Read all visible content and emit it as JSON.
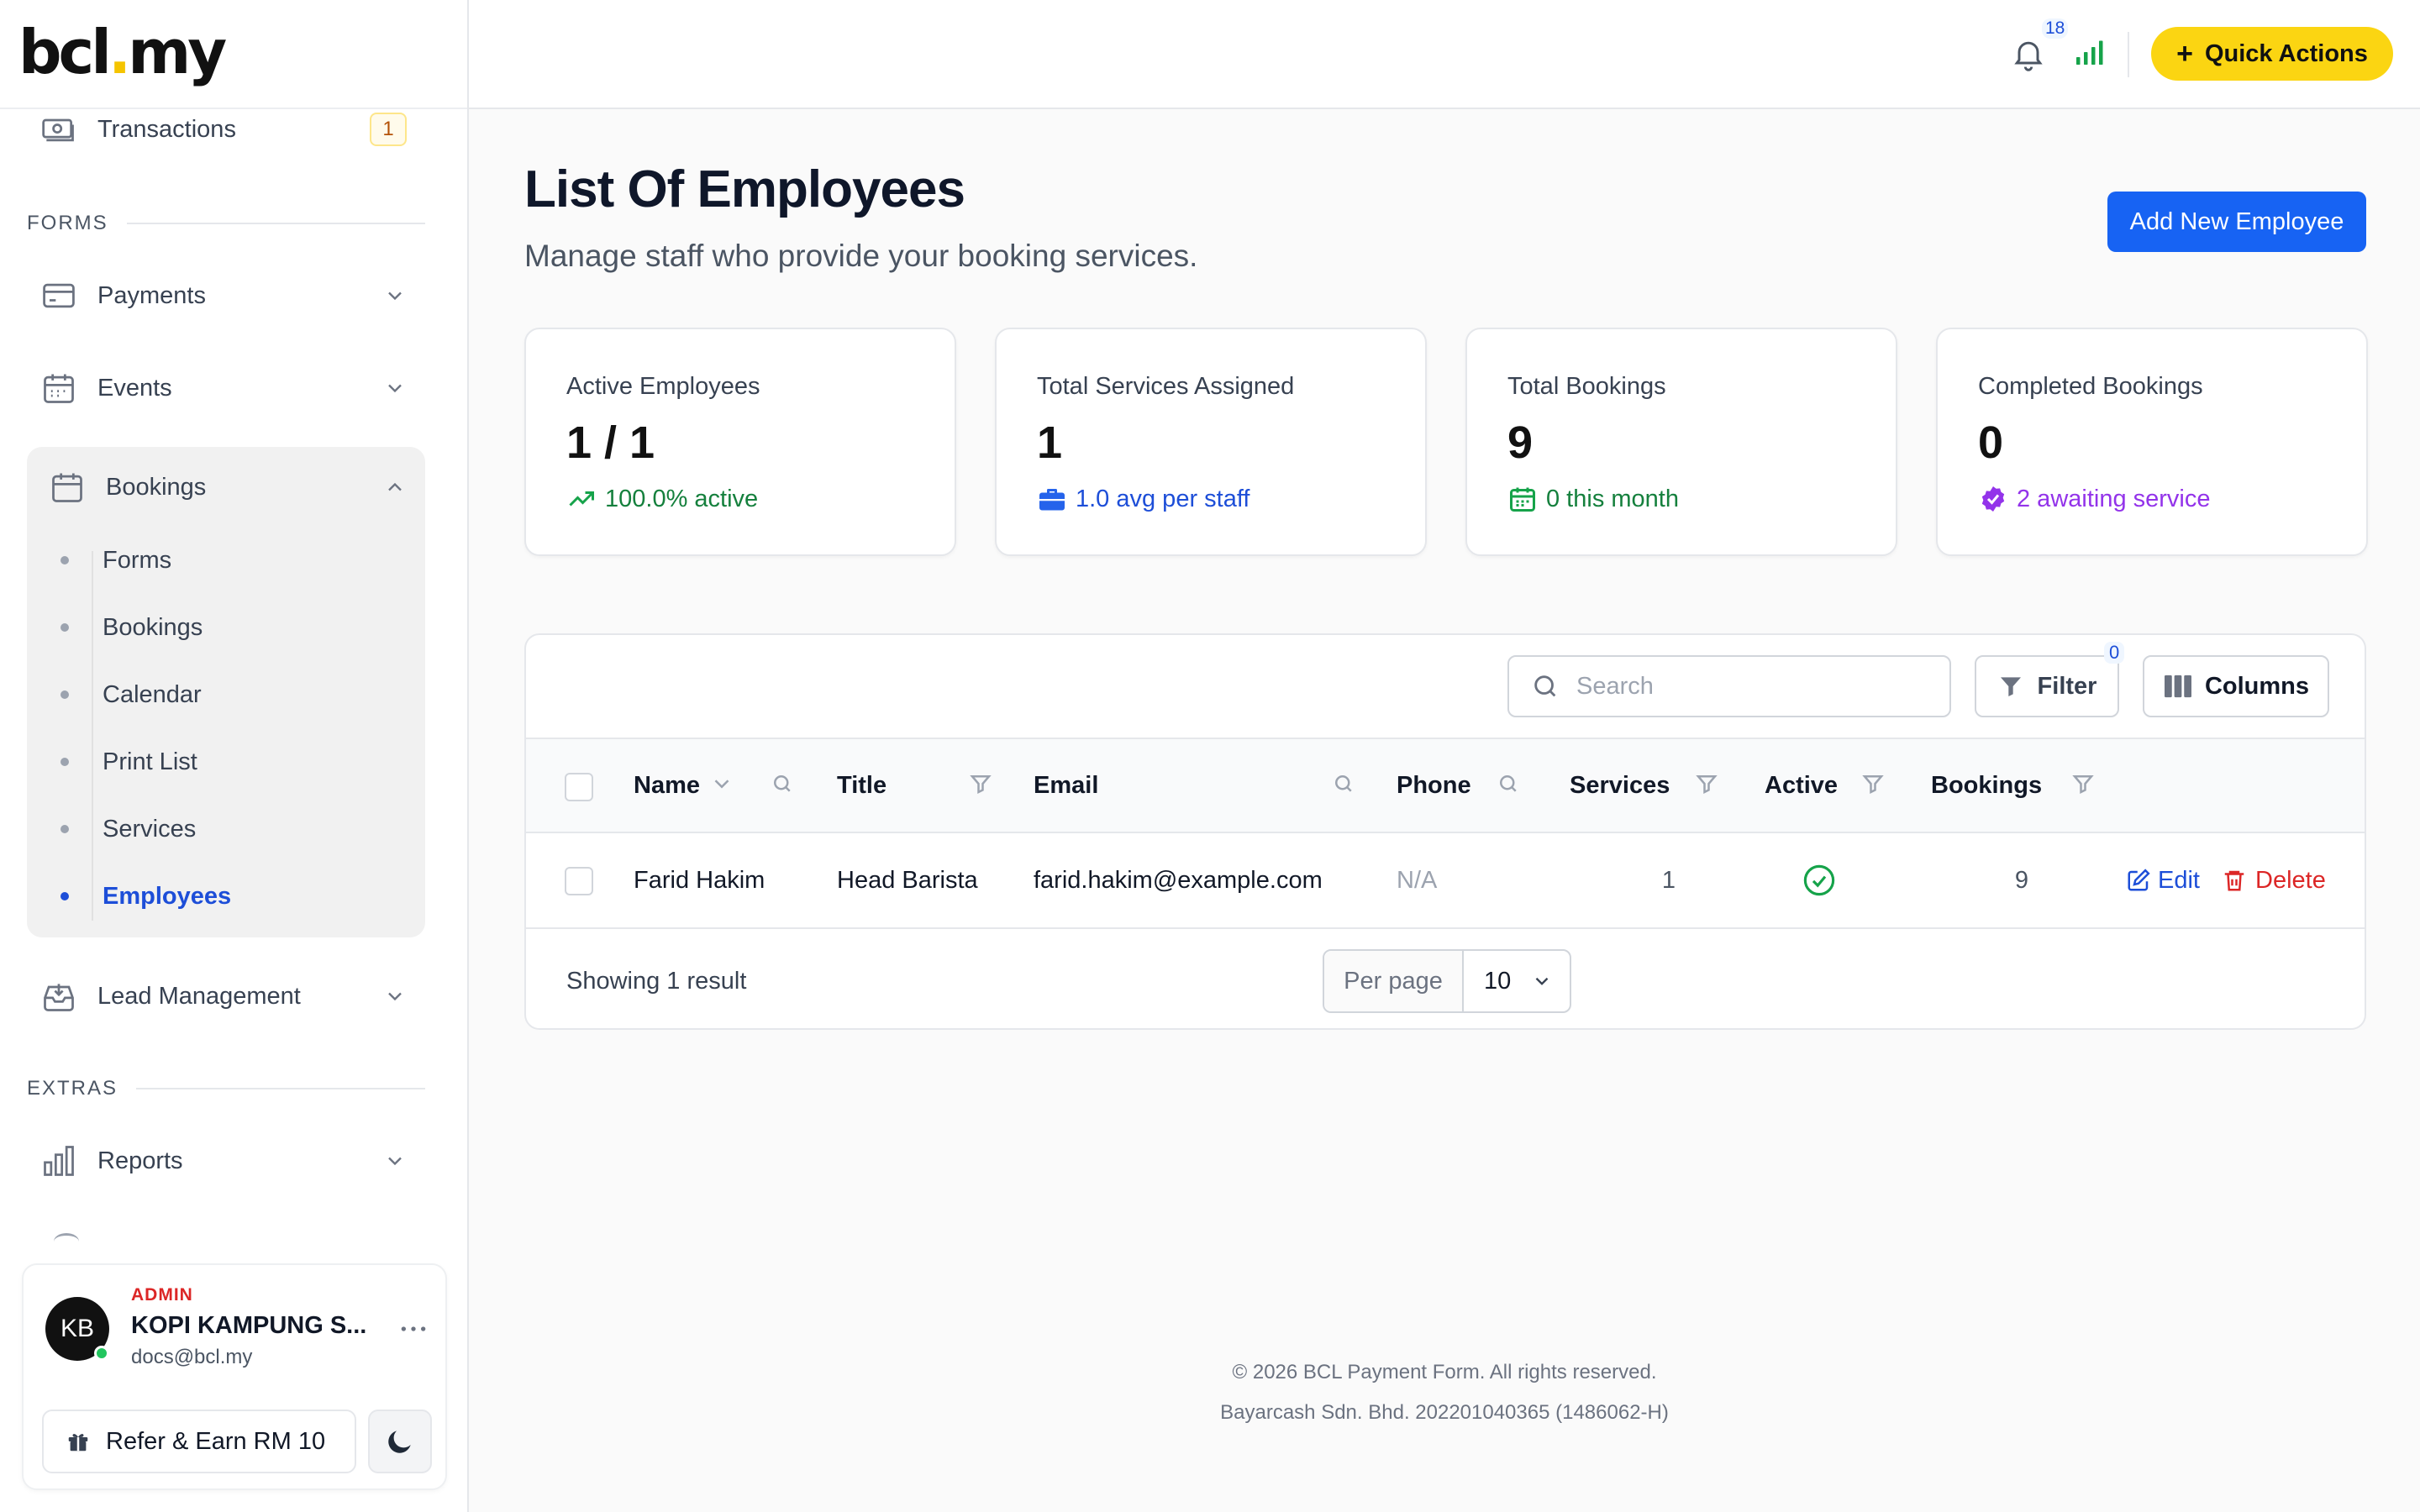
{
  "brand": {
    "logo_left": "bcl",
    "logo_dot": ".",
    "logo_right": "my",
    "accent": "#fbd512"
  },
  "sidebar": {
    "transactions": {
      "label": "Transactions",
      "badge": "1",
      "icon": "money-icon"
    },
    "forms_section": "FORMS",
    "payments": {
      "label": "Payments",
      "icon": "credit-card-icon"
    },
    "events": {
      "label": "Events",
      "icon": "calendar-icon"
    },
    "bookings": {
      "label": "Bookings",
      "icon": "calendar-icon",
      "items": [
        {
          "label": "Forms"
        },
        {
          "label": "Bookings"
        },
        {
          "label": "Calendar"
        },
        {
          "label": "Print List"
        },
        {
          "label": "Services"
        },
        {
          "label": "Employees",
          "active": true
        }
      ]
    },
    "lead_management": {
      "label": "Lead Management",
      "icon": "inbox-icon"
    },
    "extras_section": "EXTRAS",
    "reports": {
      "label": "Reports",
      "icon": "bar-chart-icon"
    }
  },
  "user": {
    "initials": "KB",
    "role": "ADMIN",
    "org_name": "KOPI KAMPUNG S...",
    "email": "docs@bcl.my",
    "refer_label": "Refer & Earn RM 10"
  },
  "topbar": {
    "notifications_count": "18",
    "quick_actions_label": "Quick Actions"
  },
  "page": {
    "title": "List Of Employees",
    "subtitle": "Manage staff who provide your booking services.",
    "add_button": "Add New Employee"
  },
  "stats": [
    {
      "label": "Active Employees",
      "value": "1 / 1",
      "foot": "100.0% active",
      "foot_color": "#15803d",
      "icon": "trending-up-icon"
    },
    {
      "label": "Total Services Assigned",
      "value": "1",
      "foot": "1.0 avg per staff",
      "foot_color": "#1d4ed8",
      "icon": "briefcase-icon"
    },
    {
      "label": "Total Bookings",
      "value": "9",
      "foot": "0 this month",
      "foot_color": "#15803d",
      "icon": "calendar-icon"
    },
    {
      "label": "Completed Bookings",
      "value": "0",
      "foot": "2 awaiting service",
      "foot_color": "#9333ea",
      "icon": "verified-badge-icon"
    }
  ],
  "table": {
    "search_placeholder": "Search",
    "filter_label": "Filter",
    "filter_count": "0",
    "columns_label": "Columns",
    "headers": {
      "name": "Name",
      "title": "Title",
      "email": "Email",
      "phone": "Phone",
      "services": "Services",
      "active": "Active",
      "bookings": "Bookings"
    },
    "rows": [
      {
        "name": "Farid Hakim",
        "title": "Head Barista",
        "email": "farid.hakim@example.com",
        "phone": "N/A",
        "services": "1",
        "active": true,
        "bookings": "9",
        "edit_label": "Edit",
        "delete_label": "Delete"
      }
    ],
    "showing": "Showing 1 result",
    "per_page_label": "Per page",
    "per_page_value": "10"
  },
  "footer": {
    "copyright": "© 2026 BCL Payment Form. All rights reserved.",
    "company": "Bayarcash Sdn. Bhd. 202201040365 (1486062-H)"
  }
}
